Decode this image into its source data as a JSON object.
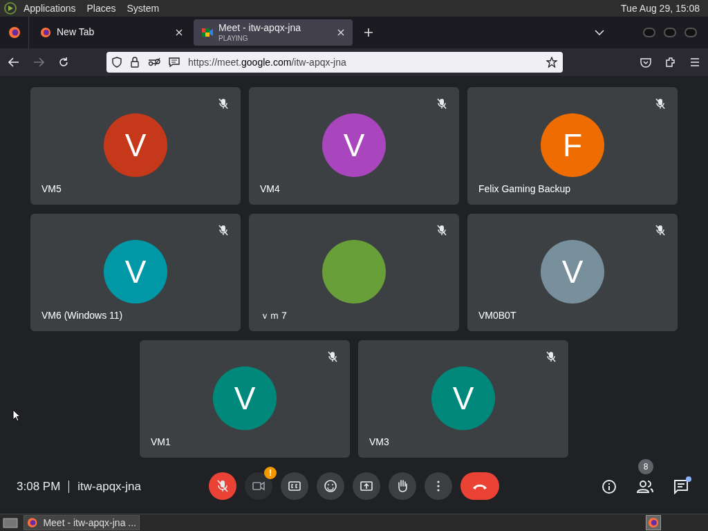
{
  "top_panel": {
    "menus": [
      "Applications",
      "Places",
      "System"
    ],
    "clock": "Tue Aug 29, 15:08"
  },
  "browser": {
    "tabs": [
      {
        "title": "New Tab",
        "kind": "firefox",
        "selected": false
      },
      {
        "title": "Meet - itw-apqx-jna",
        "subtitle": "PLAYING",
        "kind": "meet",
        "selected": true
      }
    ],
    "url_prefix": "https://meet.",
    "url_domain": "google.com",
    "url_path": "/itw-apqx-jna"
  },
  "tiles": [
    {
      "name": "VM5",
      "letter": "V",
      "color": "#c5391a",
      "muted": true
    },
    {
      "name": "VM4",
      "letter": "V",
      "color": "#a946bd",
      "muted": true
    },
    {
      "name": "Felix Gaming Backup",
      "letter": "F",
      "color": "#ef6c00",
      "muted": true
    },
    {
      "name": "VM6 (Windows 11)",
      "letter": "V",
      "color": "#0097a7",
      "muted": true
    },
    {
      "name": "ｖｍ７",
      "color": "#689f38",
      "muted": true
    },
    {
      "name": "VM0B0T",
      "letter": "V",
      "color": "#78909c",
      "muted": true
    },
    {
      "name": "VM1",
      "letter": "V",
      "color": "#00897b",
      "muted": true
    },
    {
      "name": "VM3",
      "letter": "V",
      "color": "#00897b",
      "muted": true
    }
  ],
  "meeting": {
    "time": "3:08 PM",
    "code": "itw-apqx-jna",
    "people_count": "8",
    "camera_badge": "!"
  },
  "controls": [
    {
      "kind": "mic",
      "off": true
    },
    {
      "kind": "camera",
      "off": true
    },
    {
      "kind": "captions",
      "off": false
    },
    {
      "kind": "emoji",
      "off": false
    },
    {
      "kind": "present",
      "off": false
    },
    {
      "kind": "hand",
      "off": false
    },
    {
      "kind": "more",
      "off": false
    },
    {
      "kind": "end"
    }
  ],
  "taskbar": {
    "window_title": "Meet - itw-apqx-jna ..."
  }
}
